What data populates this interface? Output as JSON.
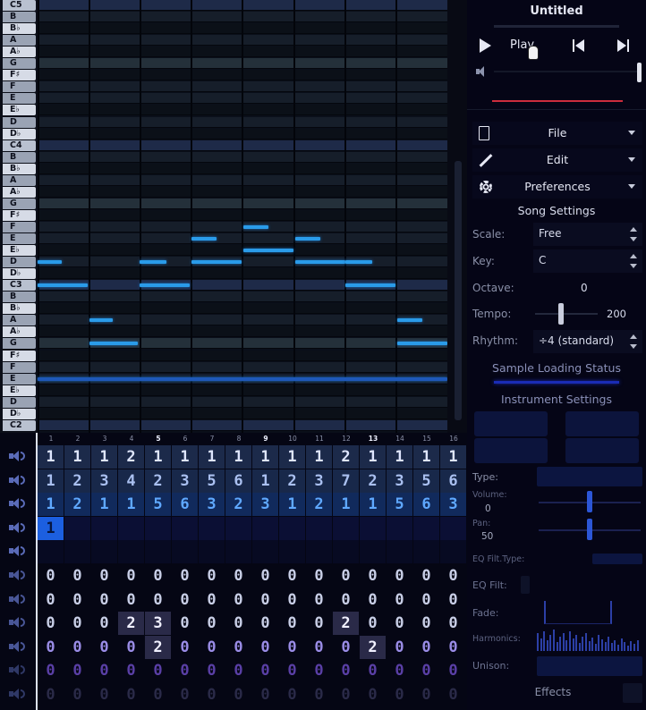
{
  "piano_roll": {
    "keys": [
      "C5",
      "B",
      "B♭",
      "A",
      "A♭",
      "G",
      "F♯",
      "F",
      "E",
      "E♭",
      "D",
      "D♭",
      "C4",
      "B",
      "B♭",
      "A",
      "A♭",
      "G",
      "F♯",
      "F",
      "E",
      "E♭",
      "D",
      "D♭",
      "C3",
      "B",
      "B♭",
      "A",
      "A♭",
      "G",
      "F♯",
      "F",
      "E",
      "E♭",
      "D",
      "D♭",
      "C2"
    ],
    "accent_color": "#2a9be9"
  },
  "pattern": {
    "bar_numbers": [
      "1",
      "2",
      "3",
      "4",
      "5",
      "6",
      "7",
      "8",
      "9",
      "10",
      "11",
      "12",
      "13",
      "14",
      "15",
      "16"
    ],
    "highlighted_bars": [
      5,
      9,
      13
    ],
    "rows": [
      [
        "1",
        "1",
        "1",
        "2",
        "1",
        "1",
        "1",
        "1",
        "1",
        "1",
        "1",
        "2",
        "1",
        "1",
        "1",
        "1"
      ],
      [
        "1",
        "2",
        "3",
        "4",
        "2",
        "3",
        "5",
        "6",
        "1",
        "2",
        "3",
        "7",
        "2",
        "3",
        "5",
        "6"
      ],
      [
        "1",
        "2",
        "1",
        "1",
        "5",
        "6",
        "3",
        "2",
        "3",
        "1",
        "2",
        "1",
        "1",
        "5",
        "6",
        "3"
      ],
      [
        "1",
        "",
        "",
        "",
        "",
        "",
        "",
        "",
        "",
        "",
        "",
        "",
        "",
        "",
        "",
        ""
      ],
      [
        "",
        "",
        "",
        "",
        "",
        "",
        "",
        "",
        "",
        "",
        "",
        "",
        "",
        "",
        "",
        ""
      ],
      [
        "0",
        "0",
        "0",
        "0",
        "0",
        "0",
        "0",
        "0",
        "0",
        "0",
        "0",
        "0",
        "0",
        "0",
        "0",
        "0"
      ],
      [
        "0",
        "0",
        "0",
        "0",
        "0",
        "0",
        "0",
        "0",
        "0",
        "0",
        "0",
        "0",
        "0",
        "0",
        "0",
        "0"
      ],
      [
        "0",
        "0",
        "0",
        "2",
        "3",
        "0",
        "0",
        "0",
        "0",
        "0",
        "0",
        "2",
        "0",
        "0",
        "0",
        "0"
      ],
      [
        "0",
        "0",
        "0",
        "0",
        "2",
        "0",
        "0",
        "0",
        "0",
        "0",
        "0",
        "0",
        "2",
        "0",
        "0",
        "0"
      ],
      [
        "0",
        "0",
        "0",
        "0",
        "0",
        "0",
        "0",
        "0",
        "0",
        "0",
        "0",
        "0",
        "0",
        "0",
        "0",
        "0"
      ],
      [
        "0",
        "0",
        "0",
        "0",
        "0",
        "0",
        "0",
        "0",
        "0",
        "0",
        "0",
        "0",
        "0",
        "0",
        "0",
        "0"
      ]
    ]
  },
  "panel": {
    "title": "Untitled",
    "play_label": "Play",
    "menus": {
      "file": "File",
      "edit": "Edit",
      "preferences": "Preferences"
    },
    "song_settings": {
      "heading": "Song Settings",
      "scale_label": "Scale:",
      "scale_value": "Free",
      "key_label": "Key:",
      "key_value": "C",
      "octave_label": "Octave:",
      "octave_value": "0",
      "tempo_label": "Tempo:",
      "tempo_value": "200",
      "rhythm_label": "Rhythm:",
      "rhythm_value": "÷4 (standard)"
    },
    "sample_loading": "Sample Loading Status",
    "instrument": {
      "heading": "Instrument Settings",
      "type_label": "Type:",
      "volume_label": "Volume:",
      "volume_value": "0",
      "pan_label": "Pan:",
      "pan_value": "50",
      "eq_filt_type_label": "EQ Filt.Type:",
      "eq_filt_label": "EQ Filt:",
      "fade_label": "Fade:",
      "harmonics_label": "Harmonics:",
      "unison_label": "Unison:",
      "effects_label": "Effects"
    }
  }
}
